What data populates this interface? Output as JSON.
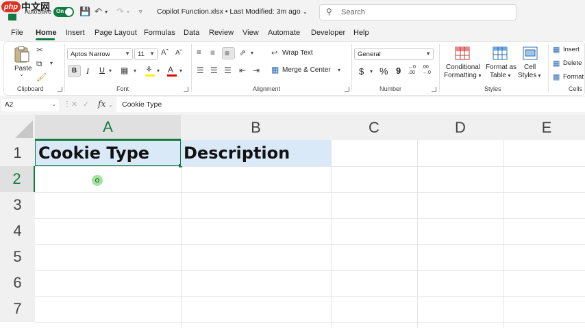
{
  "titlebar": {
    "watermark_latin": "php",
    "watermark_cjk": "中文网",
    "autosave_label": "AutoSave",
    "autosave_state": "On",
    "document_title": "Copilot Function.xlsx • Last Modified: 3m ago",
    "search_placeholder": "Search"
  },
  "tabs": [
    "File",
    "Home",
    "Insert",
    "Page Layout",
    "Formulas",
    "Data",
    "Review",
    "View",
    "Automate",
    "Developer",
    "Help"
  ],
  "active_tab": "Home",
  "ribbon": {
    "clipboard": {
      "paste_label": "Paste",
      "group_label": "Clipboard"
    },
    "font": {
      "font_name": "Aptos Narrow",
      "font_size": "11",
      "bold": "B",
      "italic": "I",
      "underline": "U",
      "group_label": "Font"
    },
    "alignment": {
      "wrap_text": "Wrap Text",
      "merge_center": "Merge & Center",
      "group_label": "Alignment"
    },
    "number": {
      "format": "General",
      "currency": "$",
      "percent": "%",
      "comma": "9",
      "inc_decimal_top": "←0",
      "inc_decimal_bottom": ".00",
      "dec_decimal_top": ".00",
      "dec_decimal_bottom": "→.0",
      "group_label": "Number"
    },
    "styles": {
      "conditional_1": "Conditional",
      "conditional_2": "Formatting",
      "format_table_1": "Format as",
      "format_table_2": "Table",
      "cell_styles_1": "Cell",
      "cell_styles_2": "Styles",
      "group_label": "Styles"
    },
    "cells": {
      "insert": "Insert",
      "delete": "Delete",
      "format": "Format",
      "group_label": "Cells"
    }
  },
  "formula_bar": {
    "name_box": "A2",
    "fx": "fx",
    "content": "Cookie Type"
  },
  "grid": {
    "columns": [
      "A",
      "B",
      "C",
      "D",
      "E"
    ],
    "rows": [
      "1",
      "2",
      "3",
      "4",
      "5",
      "6",
      "7"
    ],
    "cells": {
      "A1": "Cookie Type",
      "B1": "Description"
    },
    "selected_cell": "A2",
    "header_fill": "#dae9f8",
    "accent": "#107c41"
  }
}
